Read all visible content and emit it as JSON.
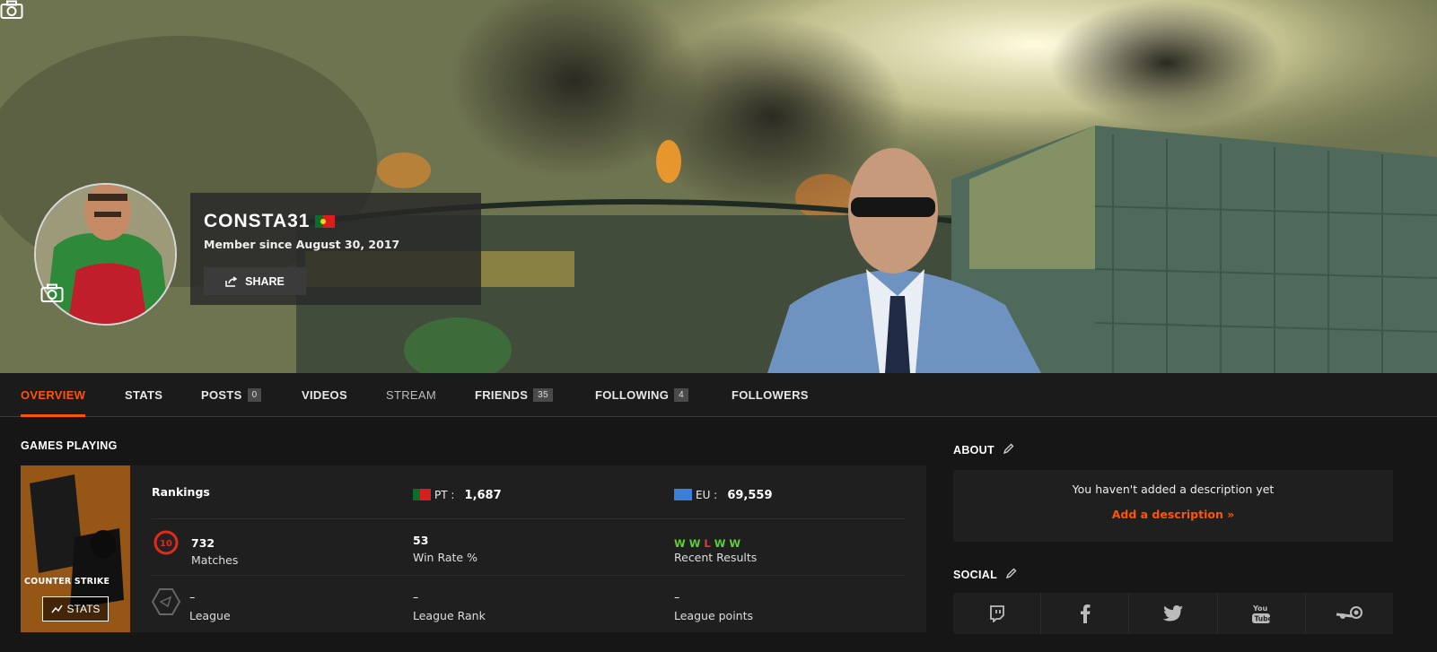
{
  "profile": {
    "username": "CONSTA31",
    "member_since": "Member since August 30, 2017",
    "share_label": "SHARE"
  },
  "nav": {
    "tabs": [
      {
        "label": "OVERVIEW",
        "badge": null
      },
      {
        "label": "STATS",
        "badge": null
      },
      {
        "label": "POSTS",
        "badge": "0"
      },
      {
        "label": "VIDEOS",
        "badge": null
      },
      {
        "label": "STREAM",
        "badge": null
      },
      {
        "label": "FRIENDS",
        "badge": "35"
      },
      {
        "label": "FOLLOWING",
        "badge": "4"
      },
      {
        "label": "FOLLOWERS",
        "badge": null
      }
    ]
  },
  "games": {
    "title": "GAMES PLAYING",
    "game_name": "COUNTER STRIKE",
    "stats_label": "STATS",
    "rankings_label": "Rankings",
    "pt_label": "PT :",
    "pt_value": "1,687",
    "eu_label": "EU :",
    "eu_value": "69,559",
    "level": "10",
    "matches_value": "732",
    "matches_label": "Matches",
    "winrate_value": "53",
    "winrate_label": "Win Rate %",
    "recent_results": [
      "W",
      "W",
      "L",
      "W",
      "W"
    ],
    "recent_label": "Recent Results",
    "league_value": "–",
    "league_label": "League",
    "league_rank_value": "–",
    "league_rank_label": "League Rank",
    "league_points_value": "–",
    "league_points_label": "League points"
  },
  "about": {
    "title": "ABOUT",
    "text": "You haven't added a description yet",
    "link": "Add a description »"
  },
  "social": {
    "title": "SOCIAL",
    "items": [
      "twitch-icon",
      "facebook-icon",
      "twitter-icon",
      "youtube-icon",
      "steam-icon"
    ]
  },
  "colors": {
    "accent": "#ff5500",
    "win": "#5fce2f",
    "loss": "#e23a3a"
  }
}
